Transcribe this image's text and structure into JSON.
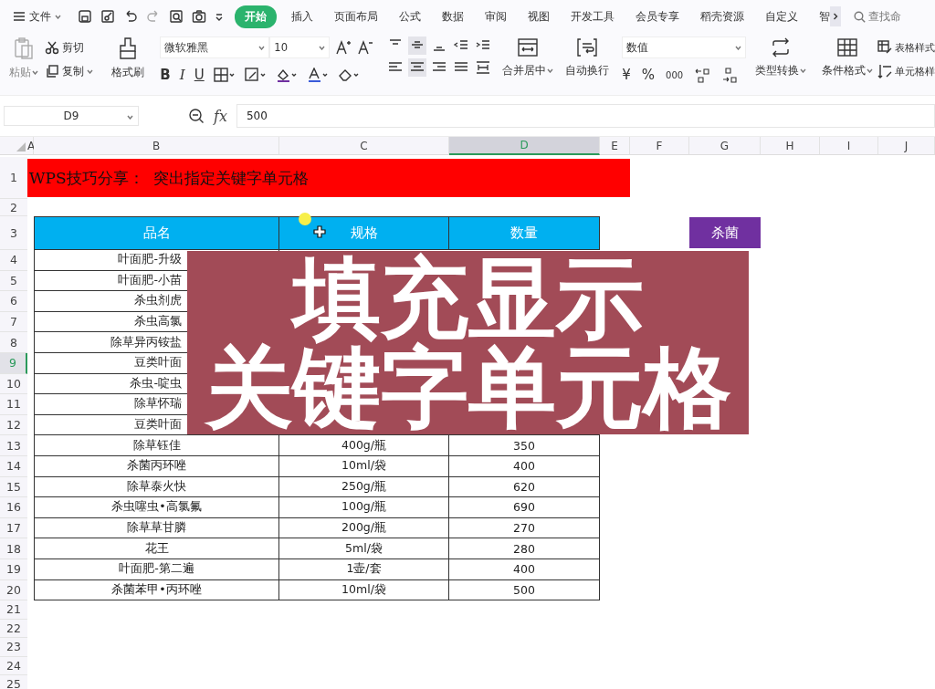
{
  "menu": {
    "label": "文件"
  },
  "tabs": [
    {
      "label": "开始",
      "selected": true
    },
    {
      "label": "插入",
      "selected": false
    },
    {
      "label": "页面布局",
      "selected": false
    },
    {
      "label": "公式",
      "selected": false
    },
    {
      "label": "数据",
      "selected": false
    },
    {
      "label": "审阅",
      "selected": false
    },
    {
      "label": "视图",
      "selected": false
    },
    {
      "label": "开发工具",
      "selected": false
    },
    {
      "label": "会员专享",
      "selected": false
    },
    {
      "label": "稻壳资源",
      "selected": false
    },
    {
      "label": "自定义",
      "selected": false
    },
    {
      "label": "智",
      "selected": false
    }
  ],
  "search": {
    "placeholder": "查找命"
  },
  "ribbon": {
    "paste": "粘贴",
    "cut": "剪切",
    "copy": "复制",
    "format_painter": "格式刷",
    "font": "微软雅黑",
    "font_size": "10",
    "bold": "B",
    "italic": "I",
    "underline": "U",
    "merge": "合并居中",
    "wrap": "自动换行",
    "number_format": "数值",
    "currency": "¥",
    "percent": "%",
    "thousands": "000",
    "convert": "类型转换",
    "conditional": "条件格式",
    "table_style": "表格样式",
    "cell_style": "单元格样"
  },
  "formula_bar": {
    "cell": "D9",
    "fx": "fx",
    "value": "500"
  },
  "columns": [
    {
      "label": "A",
      "selected": false
    },
    {
      "label": "B",
      "selected": false
    },
    {
      "label": "C",
      "selected": false
    },
    {
      "label": "D",
      "selected": true
    },
    {
      "label": "E",
      "selected": false
    },
    {
      "label": "F",
      "selected": false
    },
    {
      "label": "G",
      "selected": false
    },
    {
      "label": "H",
      "selected": false
    },
    {
      "label": "I",
      "selected": false
    },
    {
      "label": "J",
      "selected": false
    }
  ],
  "row_numbers": [
    {
      "label": "1",
      "selected": false
    },
    {
      "label": "2",
      "selected": false
    },
    {
      "label": "3",
      "selected": false
    },
    {
      "label": "4",
      "selected": false
    },
    {
      "label": "5",
      "selected": false
    },
    {
      "label": "6",
      "selected": false
    },
    {
      "label": "7",
      "selected": false
    },
    {
      "label": "8",
      "selected": false
    },
    {
      "label": "9",
      "selected": true
    },
    {
      "label": "10",
      "selected": false
    },
    {
      "label": "11",
      "selected": false
    },
    {
      "label": "12",
      "selected": false
    },
    {
      "label": "13",
      "selected": false
    },
    {
      "label": "14",
      "selected": false
    },
    {
      "label": "15",
      "selected": false
    },
    {
      "label": "16",
      "selected": false
    },
    {
      "label": "17",
      "selected": false
    },
    {
      "label": "18",
      "selected": false
    },
    {
      "label": "19",
      "selected": false
    },
    {
      "label": "20",
      "selected": false
    },
    {
      "label": "21",
      "selected": false
    },
    {
      "label": "22",
      "selected": false
    },
    {
      "label": "23",
      "selected": false
    },
    {
      "label": "24",
      "selected": false
    },
    {
      "label": "25",
      "selected": false
    }
  ],
  "title": "WPS技巧分享：  突出指定关键字单元格",
  "table": {
    "columns": [
      "品名",
      "规格",
      "数量"
    ],
    "rows": [
      {
        "name": "叶面肥-升级"
      },
      {
        "name": "叶面肥-小苗"
      },
      {
        "name": "杀虫剂虎"
      },
      {
        "name": "杀虫高氯"
      },
      {
        "name": "除草异丙铵盐"
      },
      {
        "name": "豆类叶面"
      },
      {
        "name": "杀虫-啶虫"
      },
      {
        "name": "除草怀瑞"
      },
      {
        "name": "豆类叶面"
      },
      {
        "name": "除草钰佳",
        "spec": "400g/瓶",
        "qty": "350"
      },
      {
        "name": "杀菌丙环唑",
        "spec": "10ml/袋",
        "qty": "400"
      },
      {
        "name": "除草泰火快",
        "spec": "250g/瓶",
        "qty": "620"
      },
      {
        "name": "杀虫噻虫•高氯氟",
        "spec": "100g/瓶",
        "qty": "690"
      },
      {
        "name": "除草草甘膦",
        "spec": "200g/瓶",
        "qty": "270"
      },
      {
        "name": "花王",
        "spec": "5ml/袋",
        "qty": "280"
      },
      {
        "name": "叶面肥-第二遍",
        "spec": "1壶/套",
        "qty": "400"
      },
      {
        "name": "杀菌苯甲•丙环唑",
        "spec": "10ml/袋",
        "qty": "500"
      }
    ]
  },
  "filter_button": "杀菌",
  "caption": [
    "填充显示",
    "关键字单元格"
  ]
}
